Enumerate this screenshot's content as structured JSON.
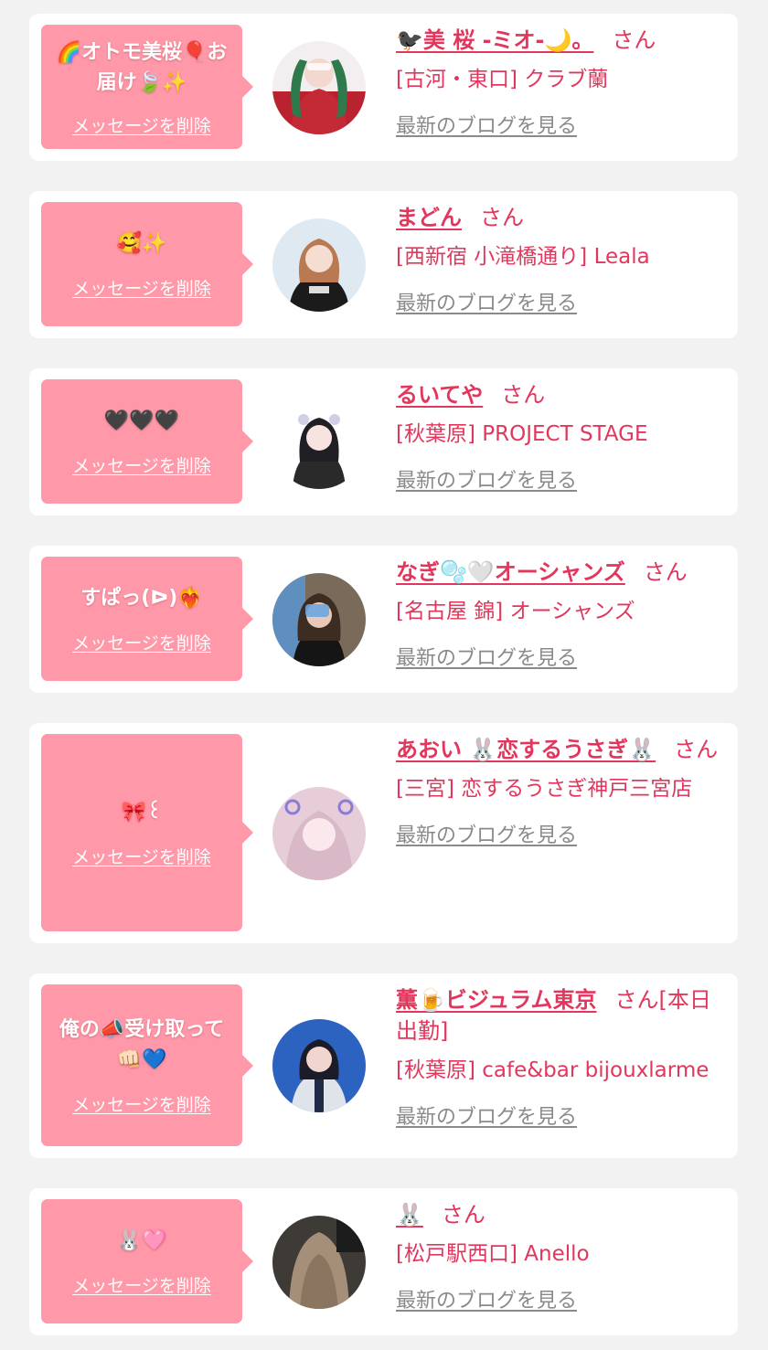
{
  "colors": {
    "page_background": "#f2f2f2",
    "card_background": "#ffffff",
    "bubble_pink": "#ff98a8",
    "name_red": "#e2365c",
    "link_gray": "#8a8a8a"
  },
  "messages": [
    {
      "bubble_text": "🌈オトモ美桜🎈お届け🍃✨",
      "delete_label": "メッセージを削除",
      "cast_name": "🐦‍⬛美 桜 -ミオ-🌙。",
      "honorific": "さん",
      "shop": "[古河・東口] クラブ蘭",
      "blog_link": "最新のブログを見る",
      "avatar_icon": "avatar-photo",
      "avatar_color": "#b8232f"
    },
    {
      "bubble_text": "🥰✨",
      "delete_label": "メッセージを削除",
      "cast_name": "まどん",
      "honorific": "さん",
      "shop": "[西新宿 小滝橋通り] Leala",
      "blog_link": "最新のブログを見る",
      "avatar_icon": "avatar-photo",
      "avatar_color": "#dfe9f2"
    },
    {
      "bubble_text": "🖤🖤🖤",
      "delete_label": "メッセージを削除",
      "cast_name": "るいてや",
      "honorific": "さん",
      "shop": "[秋葉原] PROJECT STAGE",
      "blog_link": "最新のブログを見る",
      "avatar_icon": "avatar-photo",
      "avatar_color": "#efeaee"
    },
    {
      "bubble_text": "すぱっ(ᐅ)❤️‍🔥",
      "delete_label": "メッセージを削除",
      "cast_name": "なぎ🫧🤍オーシャンズ",
      "honorific": "さん",
      "shop": "[名古屋 錦] オーシャンズ",
      "blog_link": "最新のブログを見る",
      "avatar_icon": "avatar-photo",
      "avatar_color": "#7a6a5a"
    },
    {
      "bubble_text": "🎀꒰",
      "delete_label": "メッセージを削除",
      "cast_name": "あおい 🐰恋するうさぎ🐰",
      "honorific": "さん",
      "shop": "[三宮] 恋するうさぎ神戸三宮店",
      "blog_link": "最新のブログを見る",
      "avatar_icon": "avatar-photo",
      "avatar_color": "#e6cdd8"
    },
    {
      "bubble_text": "俺の📣受け取って👊🏻💙",
      "delete_label": "メッセージを削除",
      "cast_name": "薫🍺ビジュラム東京",
      "honorific": "さん[本日出勤]",
      "shop": "[秋葉原] cafe&bar bijouxlarme",
      "blog_link": "最新のブログを見る",
      "avatar_icon": "avatar-photo",
      "avatar_color": "#2d63c0"
    },
    {
      "bubble_text": "🐰🩷",
      "delete_label": "メッセージを削除",
      "cast_name": "🐰",
      "honorific": "さん",
      "shop": "[松戸駅西口] Anello",
      "blog_link": "最新のブログを見る",
      "avatar_icon": "avatar-photo",
      "avatar_color": "#3e3a36"
    }
  ]
}
